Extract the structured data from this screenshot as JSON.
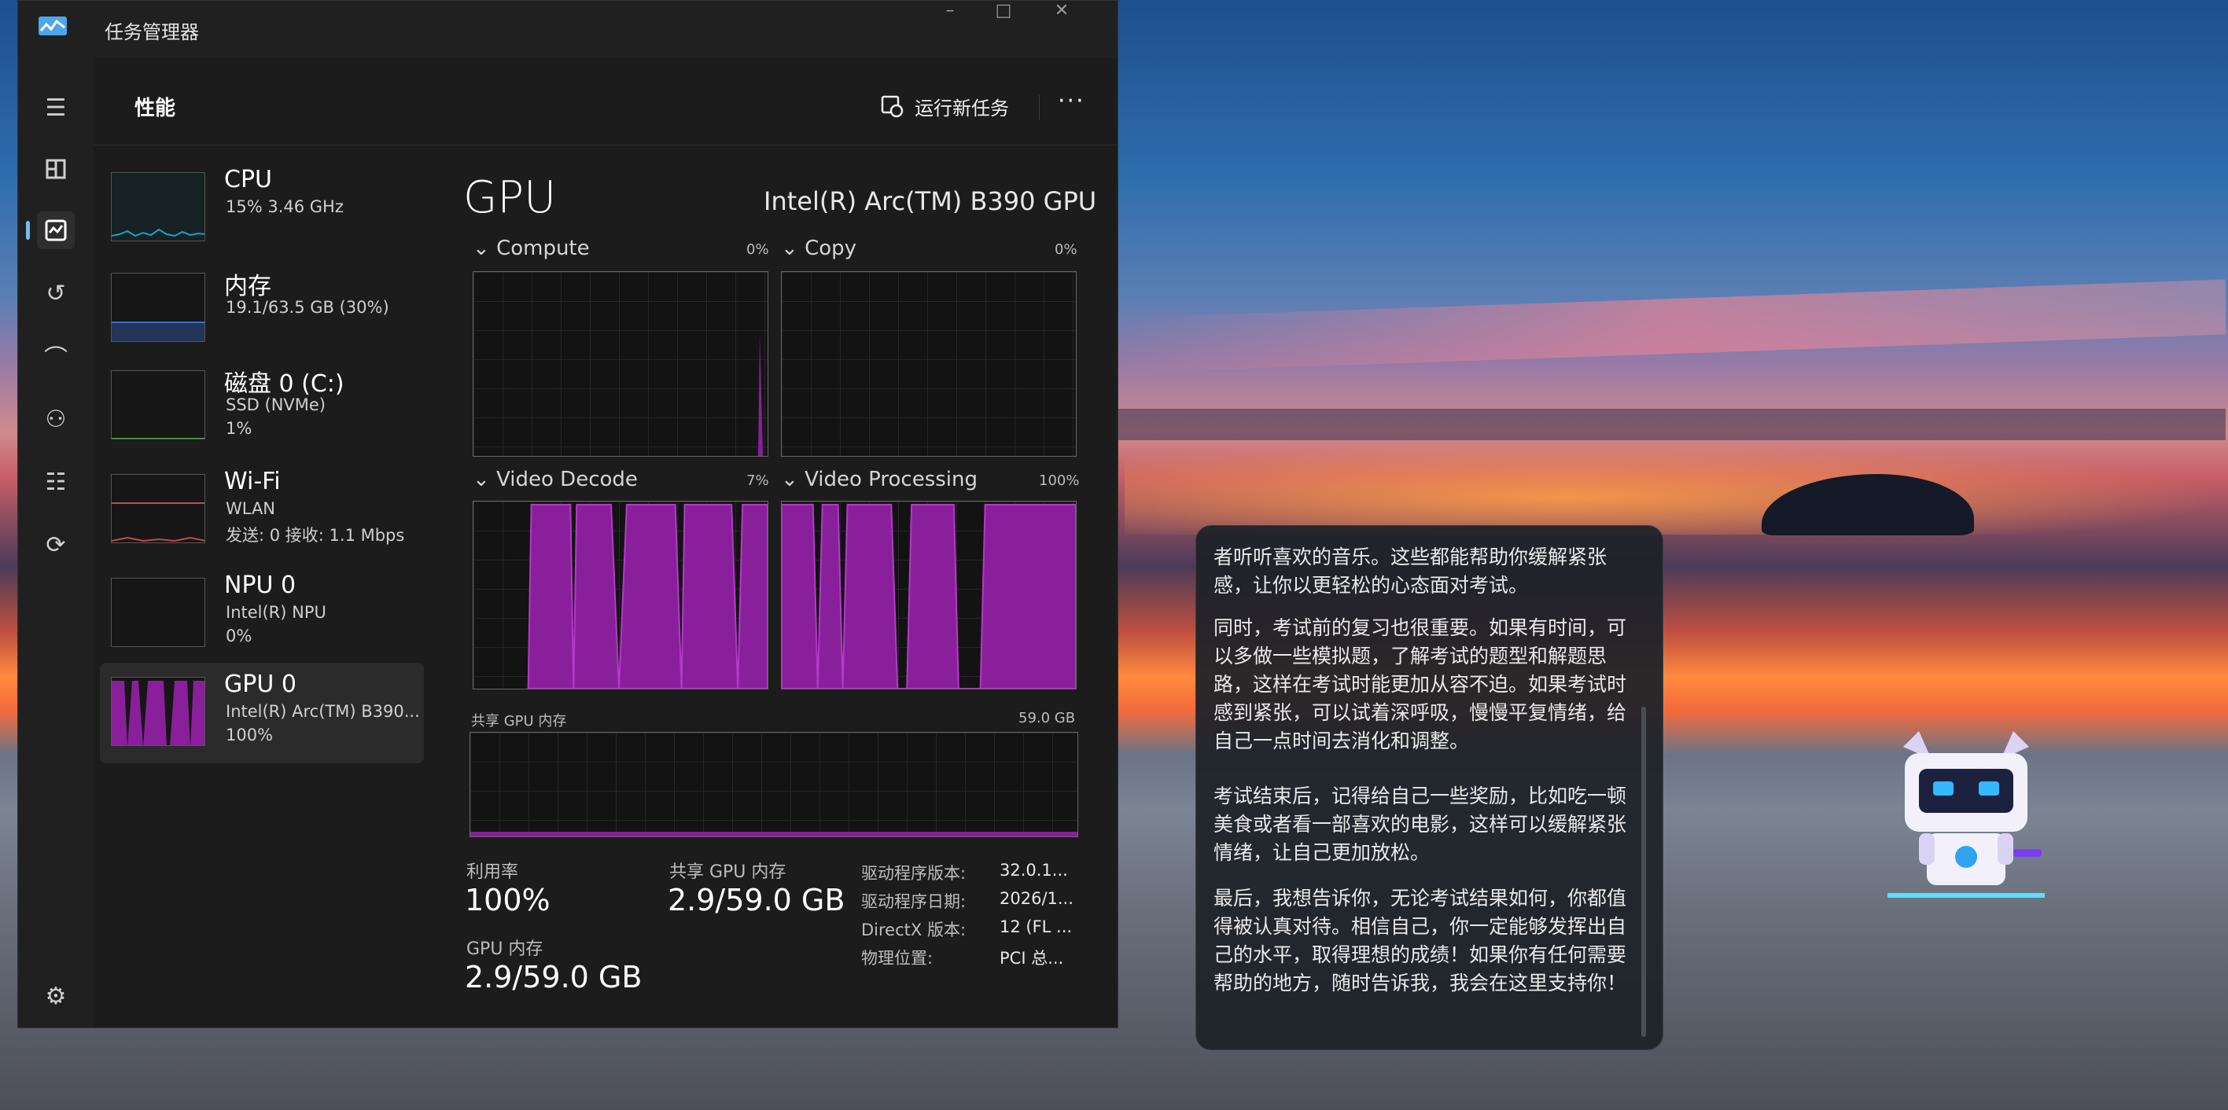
{
  "window": {
    "title": "任务管理器",
    "minimize": "–",
    "maximize": "□",
    "close": "✕"
  },
  "header": {
    "page_title": "性能",
    "run_task": "运行新任务",
    "more": "···"
  },
  "rail": {
    "icons": [
      "menu-icon",
      "processes-icon",
      "performance-icon",
      "app-history-icon",
      "startup-icon",
      "users-icon",
      "details-icon",
      "services-icon",
      "settings-icon"
    ]
  },
  "devices": [
    {
      "name": "CPU",
      "line1": "15% 3.46 GHz",
      "line2": ""
    },
    {
      "name": "内存",
      "line1": "19.1/63.5 GB (30%)",
      "line2": ""
    },
    {
      "name": "磁盘 0 (C:)",
      "line1": "SSD (NVMe)",
      "line2": "1%"
    },
    {
      "name": "Wi-Fi",
      "line1": "WLAN",
      "line2": "发送: 0 接收: 1.1 Mbps"
    },
    {
      "name": "NPU 0",
      "line1": "Intel(R) NPU",
      "line2": "0%"
    },
    {
      "name": "GPU 0",
      "line1": "Intel(R) Arc(TM) B390...",
      "line2": "100%"
    }
  ],
  "gpu": {
    "title": "GPU",
    "name": "Intel(R) Arc(TM) B390 GPU",
    "engines": [
      {
        "label": "Compute",
        "percent": "0%"
      },
      {
        "label": "Copy",
        "percent": "0%"
      },
      {
        "label": "Video Decode",
        "percent": "7%"
      },
      {
        "label": "Video Processing",
        "percent": "100%"
      }
    ],
    "shared_memory_label": "共享 GPU 内存",
    "shared_memory_max": "59.0 GB",
    "stats": {
      "utilization_label": "利用率",
      "utilization_value": "100%",
      "shared_label": "共享 GPU 内存",
      "shared_value": "2.9/59.0 GB",
      "gpu_mem_label": "GPU 内存",
      "gpu_mem_value": "2.9/59.0 GB"
    },
    "details": [
      {
        "key": "驱动程序版本:",
        "value": "32.0.1..."
      },
      {
        "key": "驱动程序日期:",
        "value": "2026/1..."
      },
      {
        "key": "DirectX 版本:",
        "value": "12 (FL ..."
      },
      {
        "key": "物理位置:",
        "value": "PCI 总..."
      }
    ]
  },
  "chat": {
    "paragraphs": [
      "者听听喜欢的音乐。这些都能帮助你缓解紧张感，让你以更轻松的心态面对考试。",
      "同时，考试前的复习也很重要。如果有时间，可以多做一些模拟题，了解考试的题型和解题思路，这样在考试时能更加从容不迫。如果考试时感到紧张，可以试着深呼吸，慢慢平复情绪，给自己一点时间去消化和调整。",
      "考试结束后，记得给自己一些奖励，比如吃一顿美食或者看一部喜欢的电影，这样可以缓解紧张情绪，让自己更加放松。",
      "最后，我想告诉你，无论考试结果如何，你都值得被认真对待。相信自己，你一定能够发挥出自己的水平，取得理想的成绩！如果你有任何需要帮助的地方，随时告诉我，我会在这里支持你！"
    ]
  },
  "colors": {
    "gpu_purple": "#8a1f9c",
    "accent_blue": "#76b9ed",
    "cpu_teal": "#1aa0c8",
    "memory_blue": "#3b6fd8",
    "wifi_red": "#c24b4b"
  }
}
